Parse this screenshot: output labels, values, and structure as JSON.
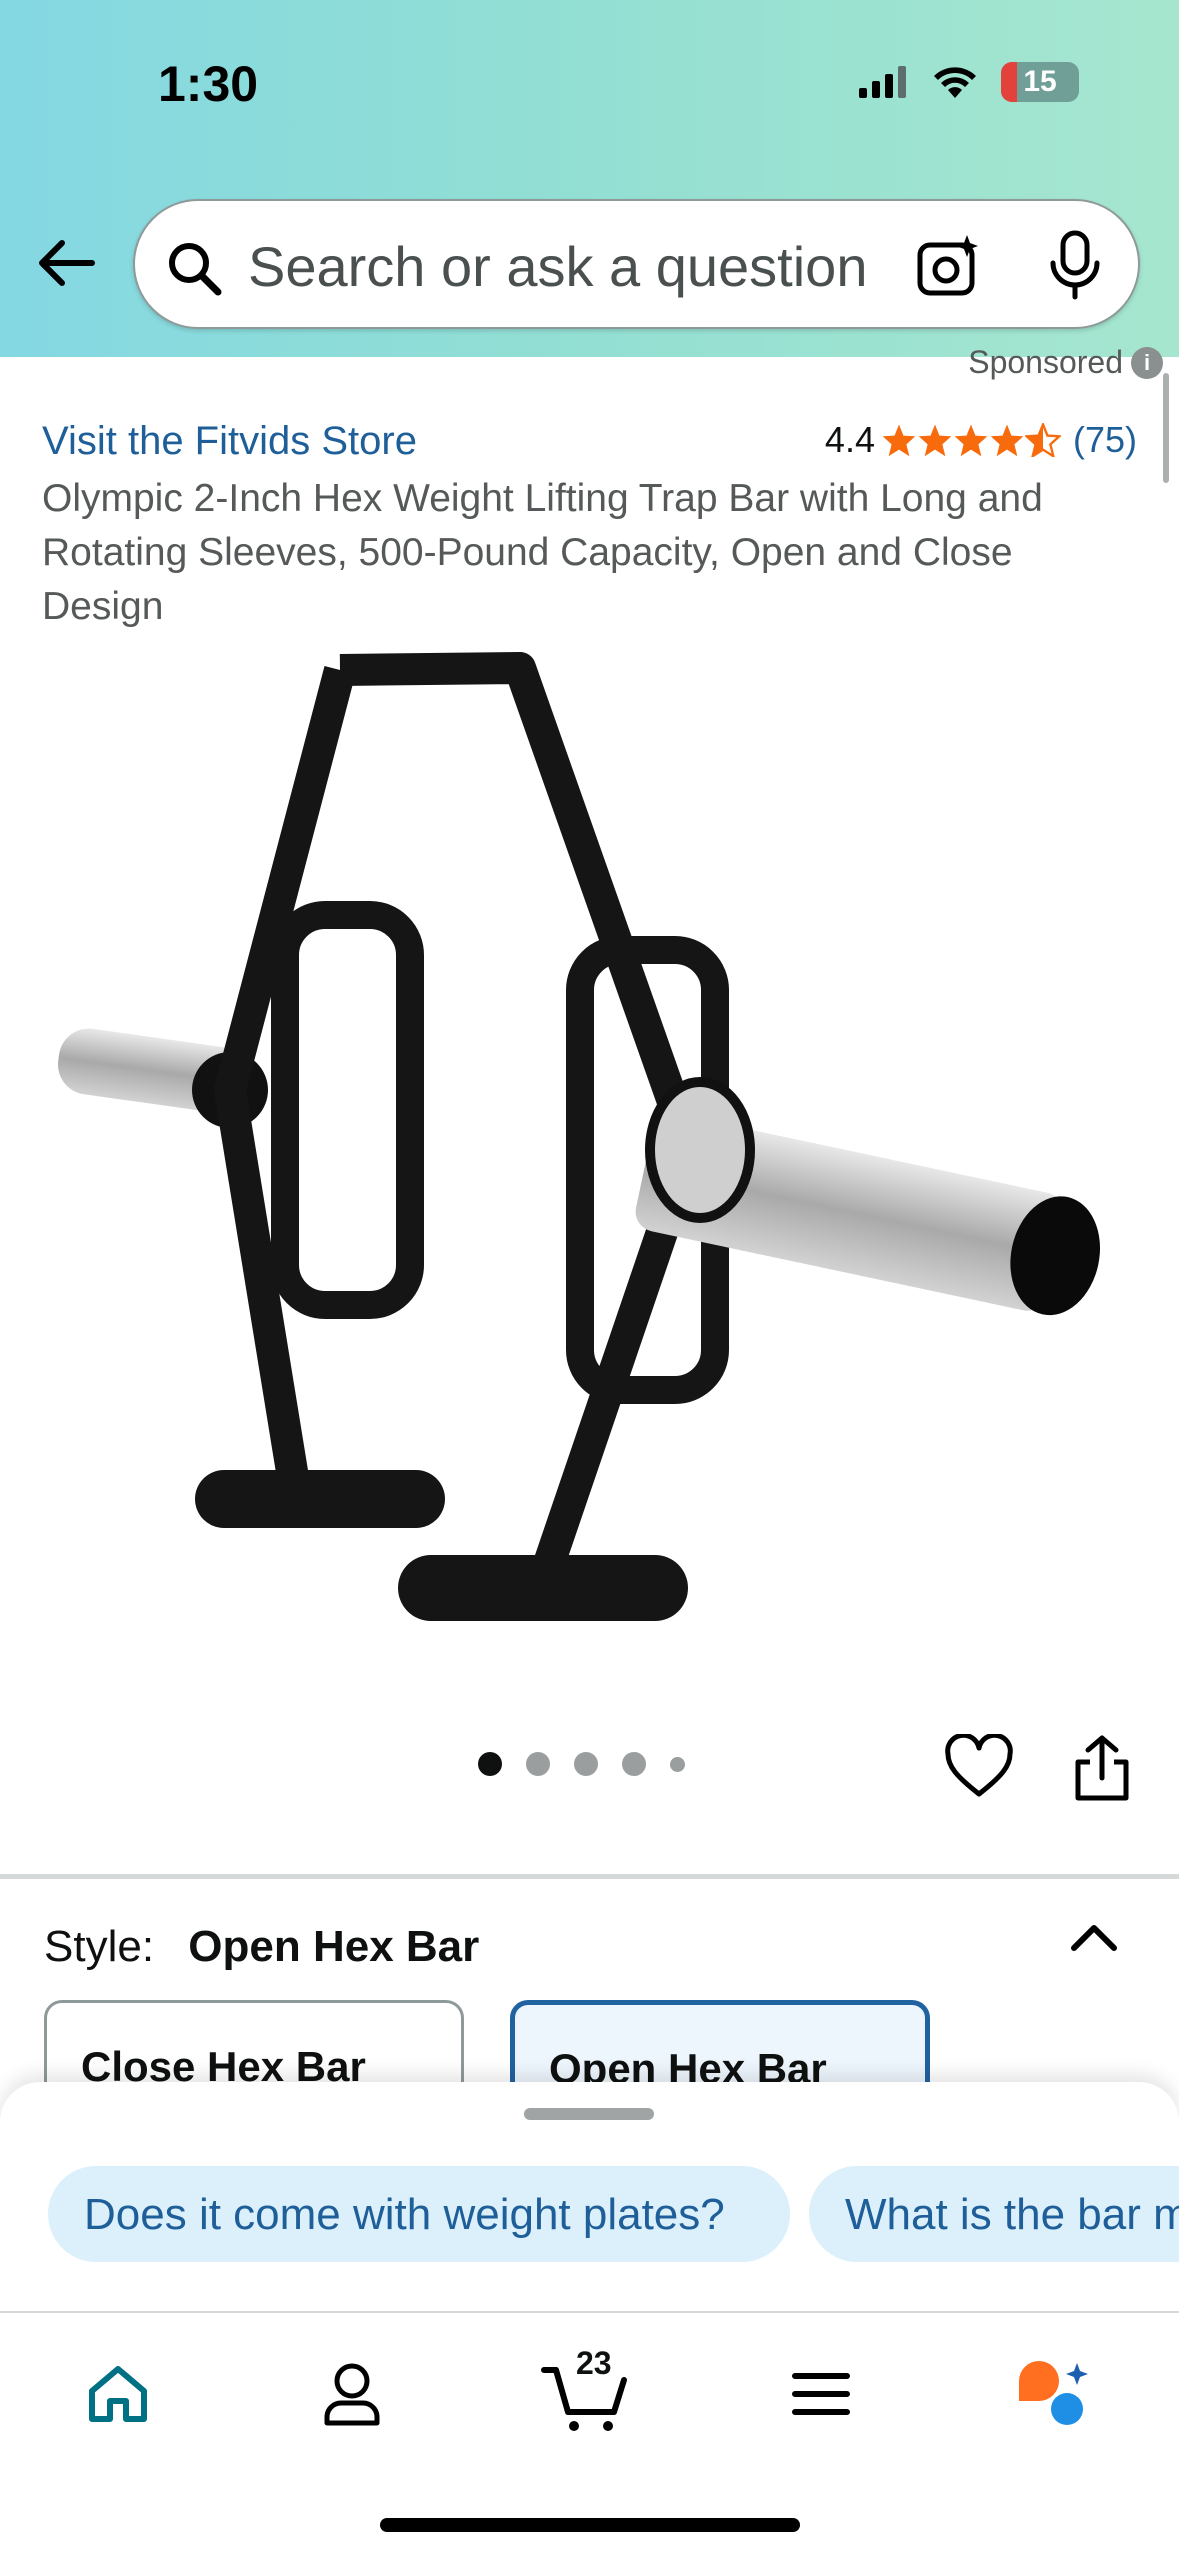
{
  "status_bar": {
    "time": "1:30",
    "battery": "15"
  },
  "search": {
    "placeholder": "Search or ask a question"
  },
  "product": {
    "sponsored_label": "Sponsored",
    "store_link": "Visit the Fitvids Store",
    "rating_value": "4.4",
    "rating_count": "(75)",
    "stars": 4.5,
    "title": "Olympic 2-Inch Hex Weight Lifting Trap Bar with Long and Rotating Sleeves, 500-Pound Capacity, Open and Close Design",
    "image_count": 5,
    "active_image": 1
  },
  "style": {
    "label": "Style:",
    "selected": "Open Hex Bar",
    "options": [
      "Close Hex Bar",
      "Open Hex Bar"
    ]
  },
  "suggestions": [
    "Does it come with weight plates?",
    "What is the bar material?"
  ],
  "tabbar": {
    "items": [
      "home-icon",
      "account-icon",
      "cart-icon",
      "menu-icon",
      "rufus-icon"
    ],
    "cart_count": "23",
    "accent": "#007185"
  },
  "colors": {
    "link": "#1f5f99",
    "star": "#f86b0c",
    "selected_border": "#2162a1"
  }
}
